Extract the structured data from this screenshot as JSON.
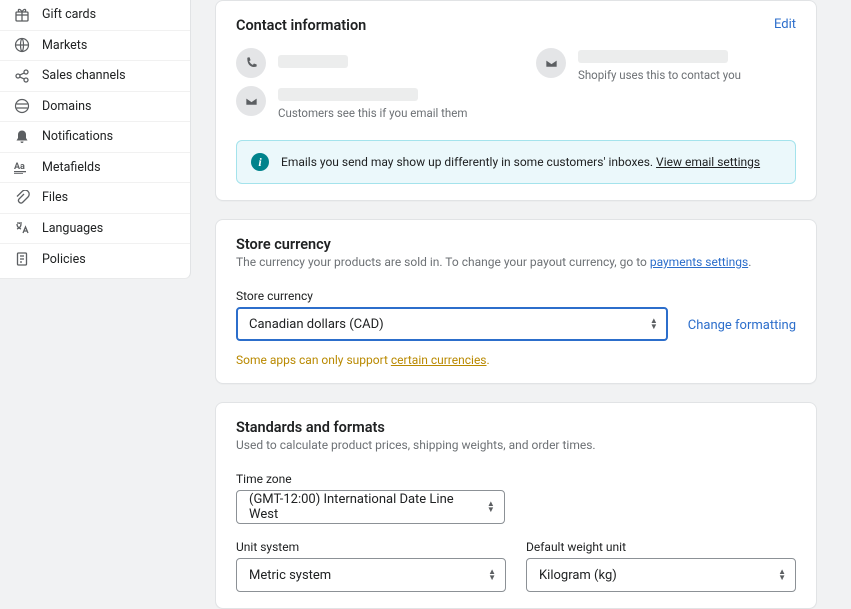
{
  "sidebar": {
    "items": [
      "Gift cards",
      "Markets",
      "Sales channels",
      "Domains",
      "Notifications",
      "Metafields",
      "Files",
      "Languages",
      "Policies"
    ]
  },
  "contact": {
    "title": "Contact information",
    "edit": "Edit",
    "email_note": "Customers see this if you email them",
    "shopify_note": "Shopify uses this to contact you",
    "banner_text": "Emails you send may show up differently in some customers' inboxes. ",
    "banner_link": "View email settings"
  },
  "currency": {
    "title": "Store currency",
    "sub_pre": "The currency your products are sold in. To change your payout currency, go to ",
    "sub_link": "payments settings",
    "label": "Store currency",
    "value": "Canadian dollars (CAD)",
    "change_link": "Change formatting",
    "warn_pre": "Some apps can only support ",
    "warn_link": "certain currencies"
  },
  "standards": {
    "title": "Standards and formats",
    "sub": "Used to calculate product prices, shipping weights, and order times.",
    "tz_label": "Time zone",
    "tz_value": "(GMT-12:00) International Date Line West",
    "unit_label": "Unit system",
    "unit_value": "Metric system",
    "weight_label": "Default weight unit",
    "weight_value": "Kilogram (kg)"
  }
}
